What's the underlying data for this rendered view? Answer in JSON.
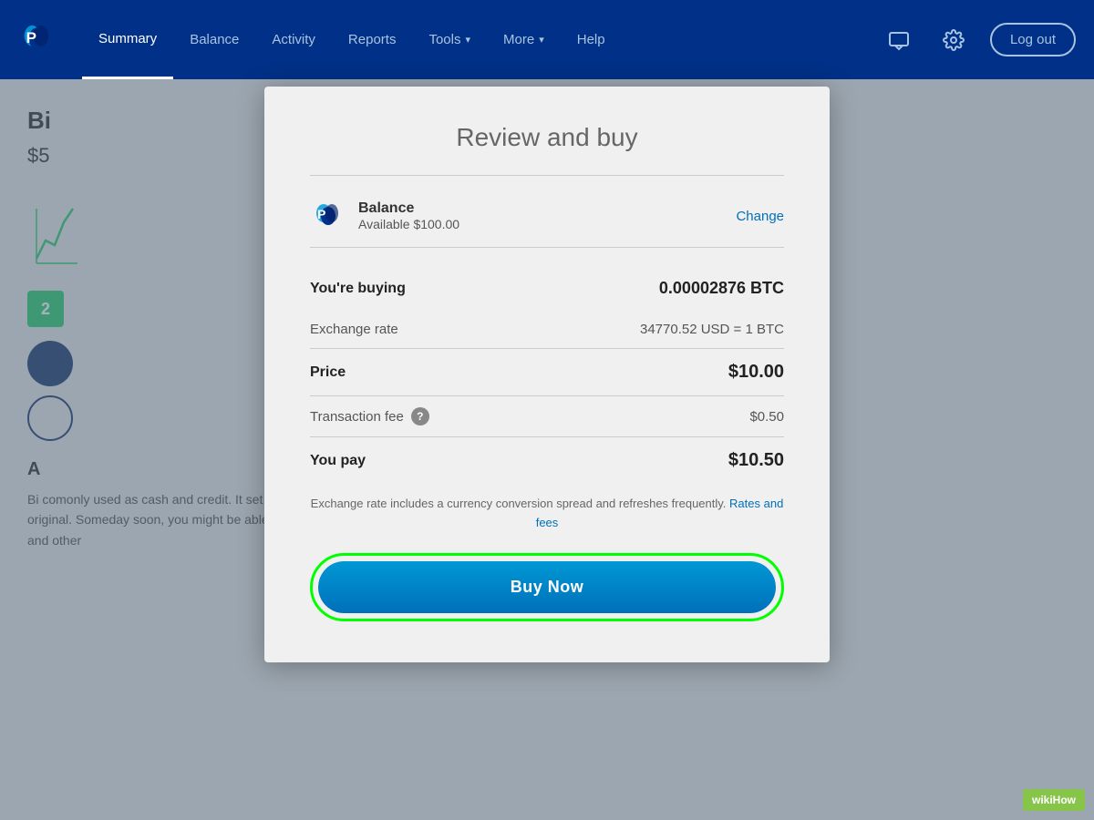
{
  "navbar": {
    "logo_alt": "PayPal",
    "links": [
      {
        "id": "summary",
        "label": "Summary",
        "active": true
      },
      {
        "id": "balance",
        "label": "Balance",
        "active": false
      },
      {
        "id": "activity",
        "label": "Activity",
        "active": false
      },
      {
        "id": "reports",
        "label": "Reports",
        "active": false
      },
      {
        "id": "tools",
        "label": "Tools",
        "active": false,
        "has_dropdown": true
      },
      {
        "id": "more",
        "label": "More",
        "active": false,
        "has_dropdown": true
      },
      {
        "id": "help",
        "label": "Help",
        "active": false
      }
    ],
    "logout_label": "Log out"
  },
  "background": {
    "title": "Bi",
    "price": "$5",
    "badge_number": "2",
    "section_title": "A",
    "body_text": "Bi                                                                          comonly used as cash and credit. It set off a revolution that has since inspired thousands of variations on the original. Someday soon, you might be able to buy just about anything and send money to anyone using bitcoins and other"
  },
  "modal": {
    "title": "Review and buy",
    "payment_method": {
      "name": "Balance",
      "available": "Available $100.00",
      "change_label": "Change"
    },
    "buying_label": "You're buying",
    "buying_value": "0.00002876 BTC",
    "exchange_rate_label": "Exchange rate",
    "exchange_rate_value": "34770.52 USD = 1 BTC",
    "price_label": "Price",
    "price_value": "$10.00",
    "transaction_fee_label": "Transaction fee",
    "transaction_fee_value": "$0.50",
    "you_pay_label": "You pay",
    "you_pay_value": "$10.50",
    "note_text": "Exchange rate includes a currency conversion spread and refreshes frequently.",
    "rates_link_label": "Rates and fees",
    "buy_now_label": "Buy Now"
  },
  "wikihow": {
    "label": "wikiHow"
  }
}
